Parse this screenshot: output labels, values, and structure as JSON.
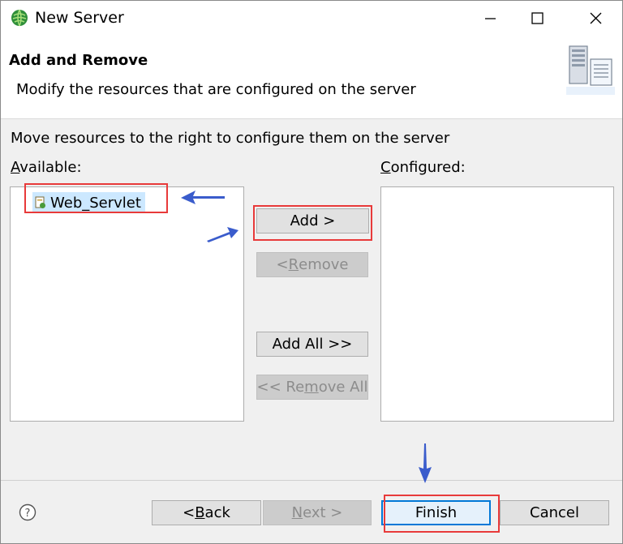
{
  "window": {
    "title": "New Server",
    "icon": "eclipse-globe-icon",
    "controls": [
      "minimize-icon",
      "maximize-icon",
      "close-icon"
    ]
  },
  "header": {
    "title": "Add and Remove",
    "subtitle": "Modify the resources that are configured on the server",
    "icon": "server-icon"
  },
  "body": {
    "instruction": "Move resources to the right to configure them on the server",
    "available": {
      "mnemonic": "A",
      "rest": "vailable:",
      "items": [
        {
          "label": "Web_Servlet",
          "icon": "web-project-icon"
        }
      ]
    },
    "configured": {
      "mnemonic": "C",
      "rest": "onfigured:",
      "items": []
    },
    "buttons": {
      "add": {
        "label": "Add >"
      },
      "remove": {
        "pre": "< ",
        "mnemonic": "R",
        "rest": "emove"
      },
      "add_all": {
        "label": "Add All >>"
      },
      "remove_all": {
        "pre": "<< Re",
        "mnemonic": "m",
        "rest": "ove All"
      }
    }
  },
  "footer": {
    "help_icon": "help-icon",
    "back": {
      "pre": "< ",
      "mnemonic": "B",
      "rest": "ack"
    },
    "next": {
      "mnemonic": "N",
      "rest": "ext >"
    },
    "finish": {
      "label": "Finish"
    },
    "cancel": {
      "label": "Cancel"
    }
  },
  "annotations": {
    "highlight_color": "#e83a3a",
    "arrow_color": "#3a5ccc"
  }
}
